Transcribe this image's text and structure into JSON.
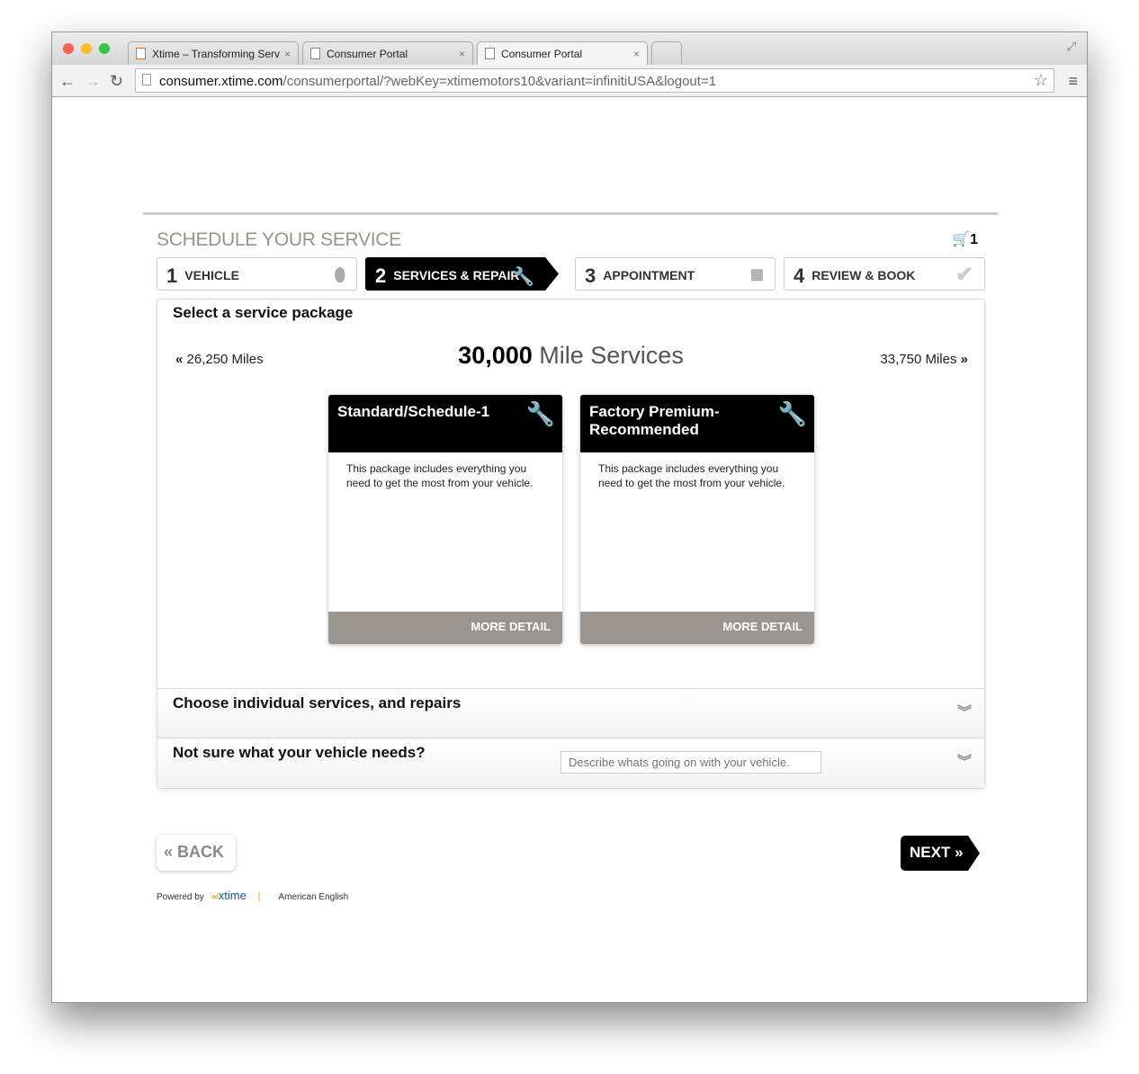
{
  "browser": {
    "tabs": [
      {
        "title": "Xtime – Transforming Serv"
      },
      {
        "title": "Consumer Portal"
      },
      {
        "title": "Consumer Portal"
      }
    ],
    "url_domain": "consumer.xtime.com",
    "url_path": "/consumerportal/?webKey=xtimemotors10&variant=infinitiUSA&logout=1"
  },
  "header": {
    "title": "SCHEDULE YOUR SERVICE",
    "cart_count": "1"
  },
  "steps": [
    {
      "num": "1",
      "label": "VEHICLE"
    },
    {
      "num": "2",
      "label": "SERVICES & REPAIR"
    },
    {
      "num": "3",
      "label": "APPOINTMENT"
    },
    {
      "num": "4",
      "label": "REVIEW & BOOK"
    }
  ],
  "main": {
    "heading": "Select a service package",
    "prev_miles": "26,250 Miles",
    "current_miles": "30,000",
    "current_suffix": "Mile Services",
    "next_miles": "33,750 Miles",
    "packages": [
      {
        "title": "Standard/Schedule-1",
        "desc": "This package includes everything you need to get the most from your vehicle.",
        "button": "MORE DETAIL"
      },
      {
        "title": "Factory Premium-Recommended",
        "desc": "This package includes everything you need to get the most from your vehicle.",
        "button": "MORE DETAIL"
      }
    ],
    "individual": "Choose individual services, and repairs",
    "not_sure": "Not sure what your vehicle needs?",
    "describe_placeholder": "Describe whats going on with your vehicle."
  },
  "nav": {
    "back": "BACK",
    "next": "NEXT"
  },
  "footer": {
    "powered_by": "Powered by",
    "brand": "xtime",
    "language": "American English"
  }
}
